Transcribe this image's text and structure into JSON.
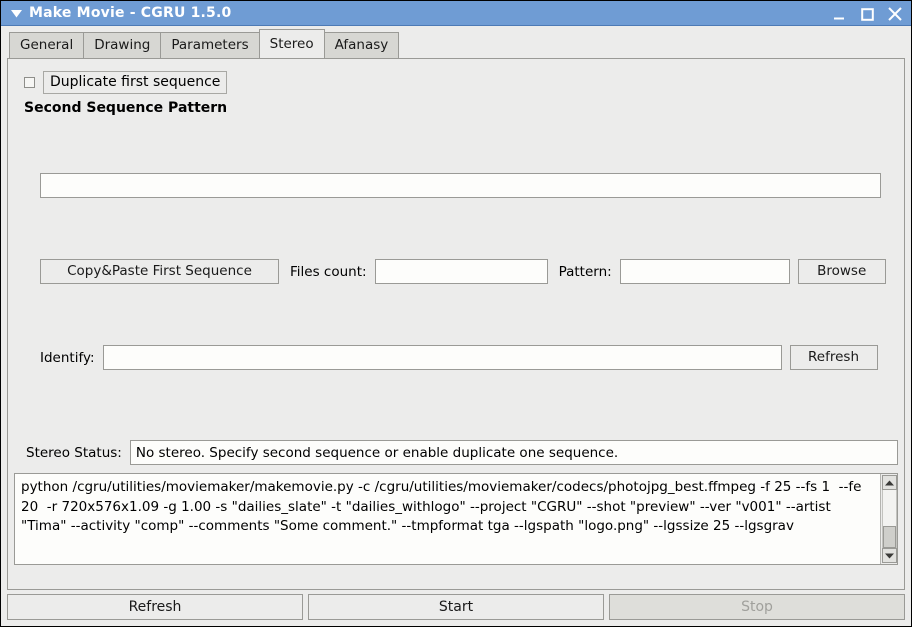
{
  "titlebar": {
    "menu_icon": "caret-down-icon",
    "title": "Make Movie - CGRU 1.5.0",
    "minimize_label": "—",
    "maximize_label": "❐",
    "close_label": "✕"
  },
  "tabs": [
    {
      "label": "General",
      "active": false
    },
    {
      "label": "Drawing",
      "active": false
    },
    {
      "label": "Parameters",
      "active": false
    },
    {
      "label": "Stereo",
      "active": true
    },
    {
      "label": "Afanasy",
      "active": false
    }
  ],
  "stereo": {
    "duplicate_checkbox_label": "Duplicate first sequence",
    "duplicate_checked": false,
    "section_title": "Second Sequence Pattern",
    "pattern_main_value": "",
    "pattern_main_placeholder": "",
    "copy_paste_button": "Copy&Paste First Sequence",
    "files_count_label": "Files count:",
    "files_count_value": "",
    "pattern_label": "Pattern:",
    "pattern_value": "",
    "browse_button": "Browse",
    "identify_label": "Identify:",
    "identify_value": "",
    "identify_refresh_button": "Refresh",
    "stereo_status_label": "Stereo Status:",
    "stereo_status_value": "No stereo. Specify second sequence or enable duplicate one sequence."
  },
  "console": {
    "text": "python /cgru/utilities/moviemaker/makemovie.py -c /cgru/utilities/moviemaker/codecs/photojpg_best.ffmpeg -f 25 --fs 1  --fe 20  -r 720x576x1.09 -g 1.00 -s \"dailies_slate\" -t \"dailies_withlogo\" --project \"CGRU\" --shot \"preview\" --ver \"v001\" --artist \"Tima\" --activity \"comp\" --comments \"Some comment.\" --tmpformat tga --lgspath \"logo.png\" --lgssize 25 --lgsgrav",
    "scroll_up_icon": "triangle-up-icon",
    "scroll_down_icon": "triangle-down-icon"
  },
  "footer": {
    "refresh_button": "Refresh",
    "start_button": "Start",
    "stop_button": "Stop",
    "stop_disabled": true
  },
  "colors": {
    "titlebar": "#6f9cd4",
    "window_bg": "#ececeb",
    "field_bg": "#fdfdfb",
    "border": "#9a9a96",
    "disabled_text": "#a0a09c"
  }
}
